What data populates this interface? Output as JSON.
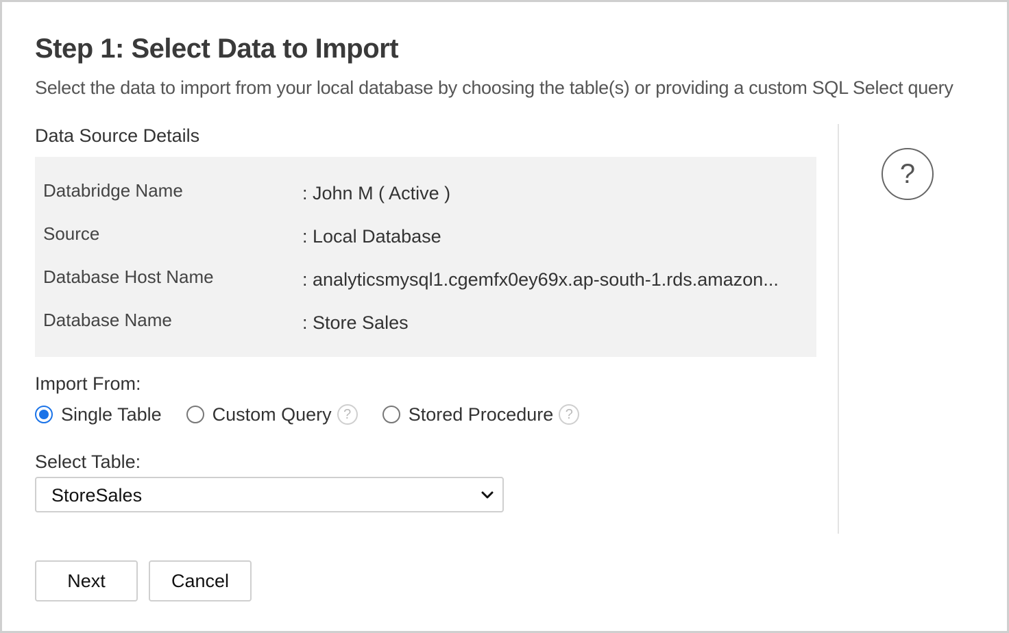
{
  "header": {
    "title": "Step 1: Select Data to Import",
    "subtitle": "Select the data to import from your local database by choosing the table(s) or providing a custom SQL Select query"
  },
  "details": {
    "section_label": "Data Source Details",
    "rows": [
      {
        "key": "Databridge Name",
        "value": "John M ( Active )"
      },
      {
        "key": "Source",
        "value": "Local Database"
      },
      {
        "key": "Database Host Name",
        "value": "analyticsmysql1.cgemfx0ey69x.ap-south-1.rds.amazon..."
      },
      {
        "key": "Database Name",
        "value": "Store Sales"
      }
    ]
  },
  "help": {
    "symbol": "?"
  },
  "import_from": {
    "label": "Import From:",
    "options": [
      {
        "label": "Single Table",
        "checked": true
      },
      {
        "label": "Custom Query",
        "checked": false,
        "help": "?"
      },
      {
        "label": "Stored Procedure",
        "checked": false,
        "help": "?"
      }
    ]
  },
  "select_table": {
    "label": "Select Table:",
    "value": "StoreSales"
  },
  "buttons": {
    "next": "Next",
    "cancel": "Cancel"
  },
  "colors": {
    "accent": "#1a73e8",
    "panel_bg": "#f2f2f2"
  }
}
